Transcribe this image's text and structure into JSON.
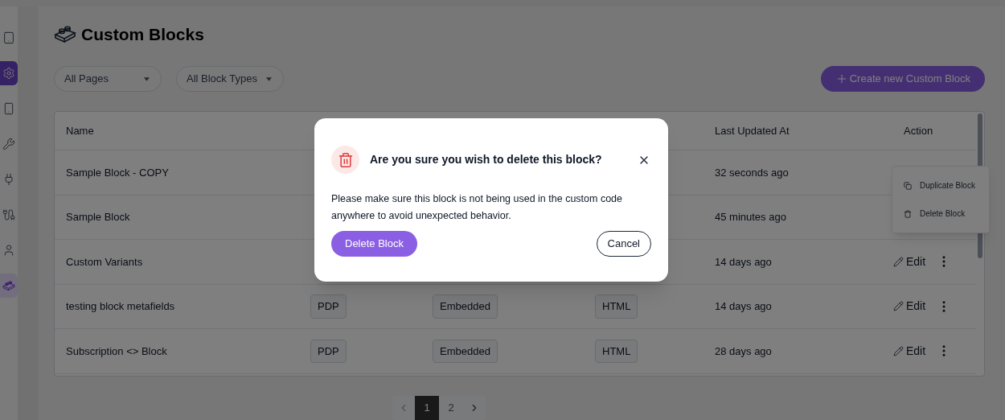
{
  "sidebar": {
    "items": [
      {
        "selected": false,
        "highlighted": false
      },
      {
        "selected": true,
        "highlighted": false
      },
      {
        "selected": false,
        "highlighted": false
      },
      {
        "selected": false,
        "highlighted": false
      },
      {
        "selected": false,
        "highlighted": false
      },
      {
        "selected": false,
        "highlighted": false
      },
      {
        "selected": false,
        "highlighted": false
      },
      {
        "selected": false,
        "highlighted": true
      }
    ]
  },
  "page": {
    "title": "Custom Blocks"
  },
  "filters": [
    {
      "value": "All Pages"
    },
    {
      "value": "All Block Types"
    }
  ],
  "create_button": "Create new Custom Block",
  "table": {
    "columns": [
      "Name",
      "Last Updated At",
      "Action"
    ],
    "rows": [
      {
        "name": "Sample Block - COPY",
        "updated": "32 seconds ago"
      },
      {
        "name": "Sample Block",
        "updated": "45 minutes ago"
      },
      {
        "name": "Custom Variants",
        "updated": "14 days ago",
        "edit": "Edit"
      },
      {
        "name": "testing block metafields",
        "page": "PDP",
        "type": "Embedded",
        "format": "HTML",
        "updated": "14 days ago",
        "edit": "Edit"
      },
      {
        "name": "Subscription <> Block",
        "page": "PDP",
        "type": "Embedded",
        "format": "HTML",
        "updated": "28 days ago",
        "edit": "Edit"
      }
    ]
  },
  "row_menu": {
    "items": [
      "Duplicate Block",
      "Delete Block"
    ]
  },
  "pagination": {
    "pages": [
      {
        "label": "1",
        "selected": true
      },
      {
        "label": "2",
        "selected": false
      }
    ]
  },
  "dialog": {
    "title": "Are you sure you wish to delete this block?",
    "message": "Please make sure this block is not being used in the custom code anywhere to avoid unexpected behavior.",
    "confirm": "Delete Block",
    "cancel": "Cancel"
  }
}
